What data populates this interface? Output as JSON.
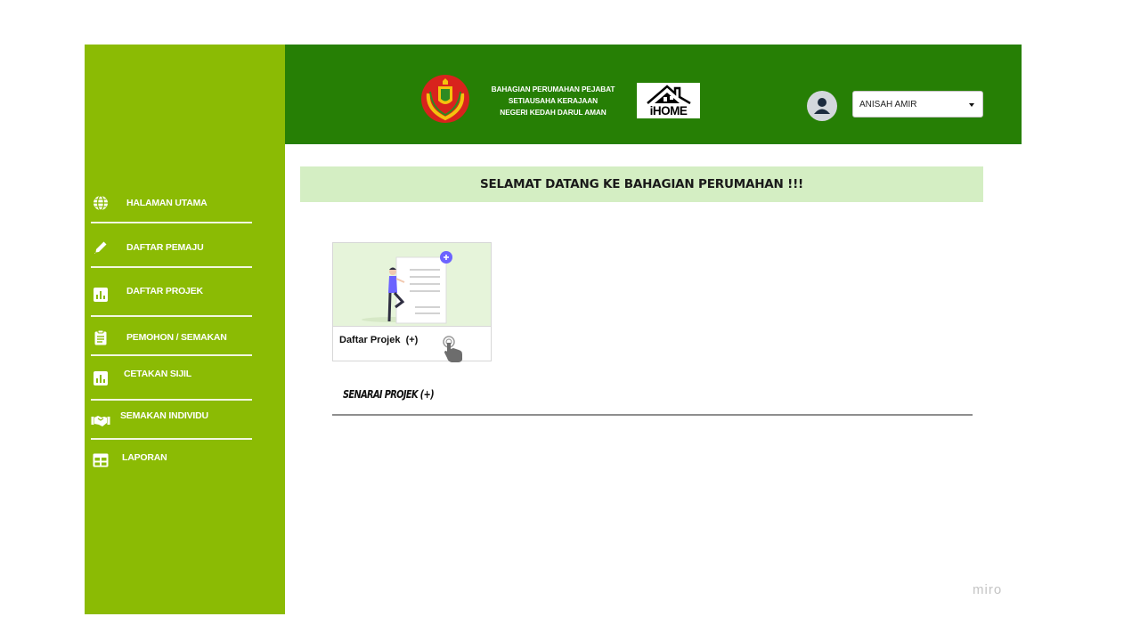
{
  "header": {
    "org_lines": [
      "BAHAGIAN PERUMAHAN PEJABAT",
      "SETIAUSAHA KERAJAAN",
      "NEGERI KEDAH DARUL AMAN"
    ],
    "ihome_logo": "iHOME",
    "crest_icon": "state-crest-icon",
    "user": {
      "avatar_icon": "user-avatar-icon",
      "selected": "ANISAH AMIR"
    }
  },
  "sidebar": {
    "items": [
      {
        "label": "HALAMAN UTAMA",
        "icon": "globe-icon"
      },
      {
        "label": "DAFTAR PEMAJU",
        "icon": "pen-icon"
      },
      {
        "label": "DAFTAR PROJEK",
        "icon": "bar-chart-icon"
      },
      {
        "label": "PEMOHON / SEMAKAN",
        "icon": "clipboard-icon"
      },
      {
        "label": "CETAKAN SIJIL",
        "icon": "bar-chart-icon"
      },
      {
        "label": "SEMAKAN INDIVIDU",
        "icon": "handshake-icon"
      },
      {
        "label": "LAPORAN",
        "icon": "table-icon"
      }
    ]
  },
  "main": {
    "welcome": "SELAMAT DATANG KE BAHAGIAN PERUMAHAN !!!",
    "card": {
      "label": "Daftar Projek  (+)"
    },
    "list_title": "SENARAI PROJEK (+)"
  },
  "watermark": "miro",
  "colors": {
    "sidebar": "#8bbb04",
    "header": "#267f05",
    "welcome_banner": "#d4eec3",
    "accent_plus": "#6c63ff"
  }
}
